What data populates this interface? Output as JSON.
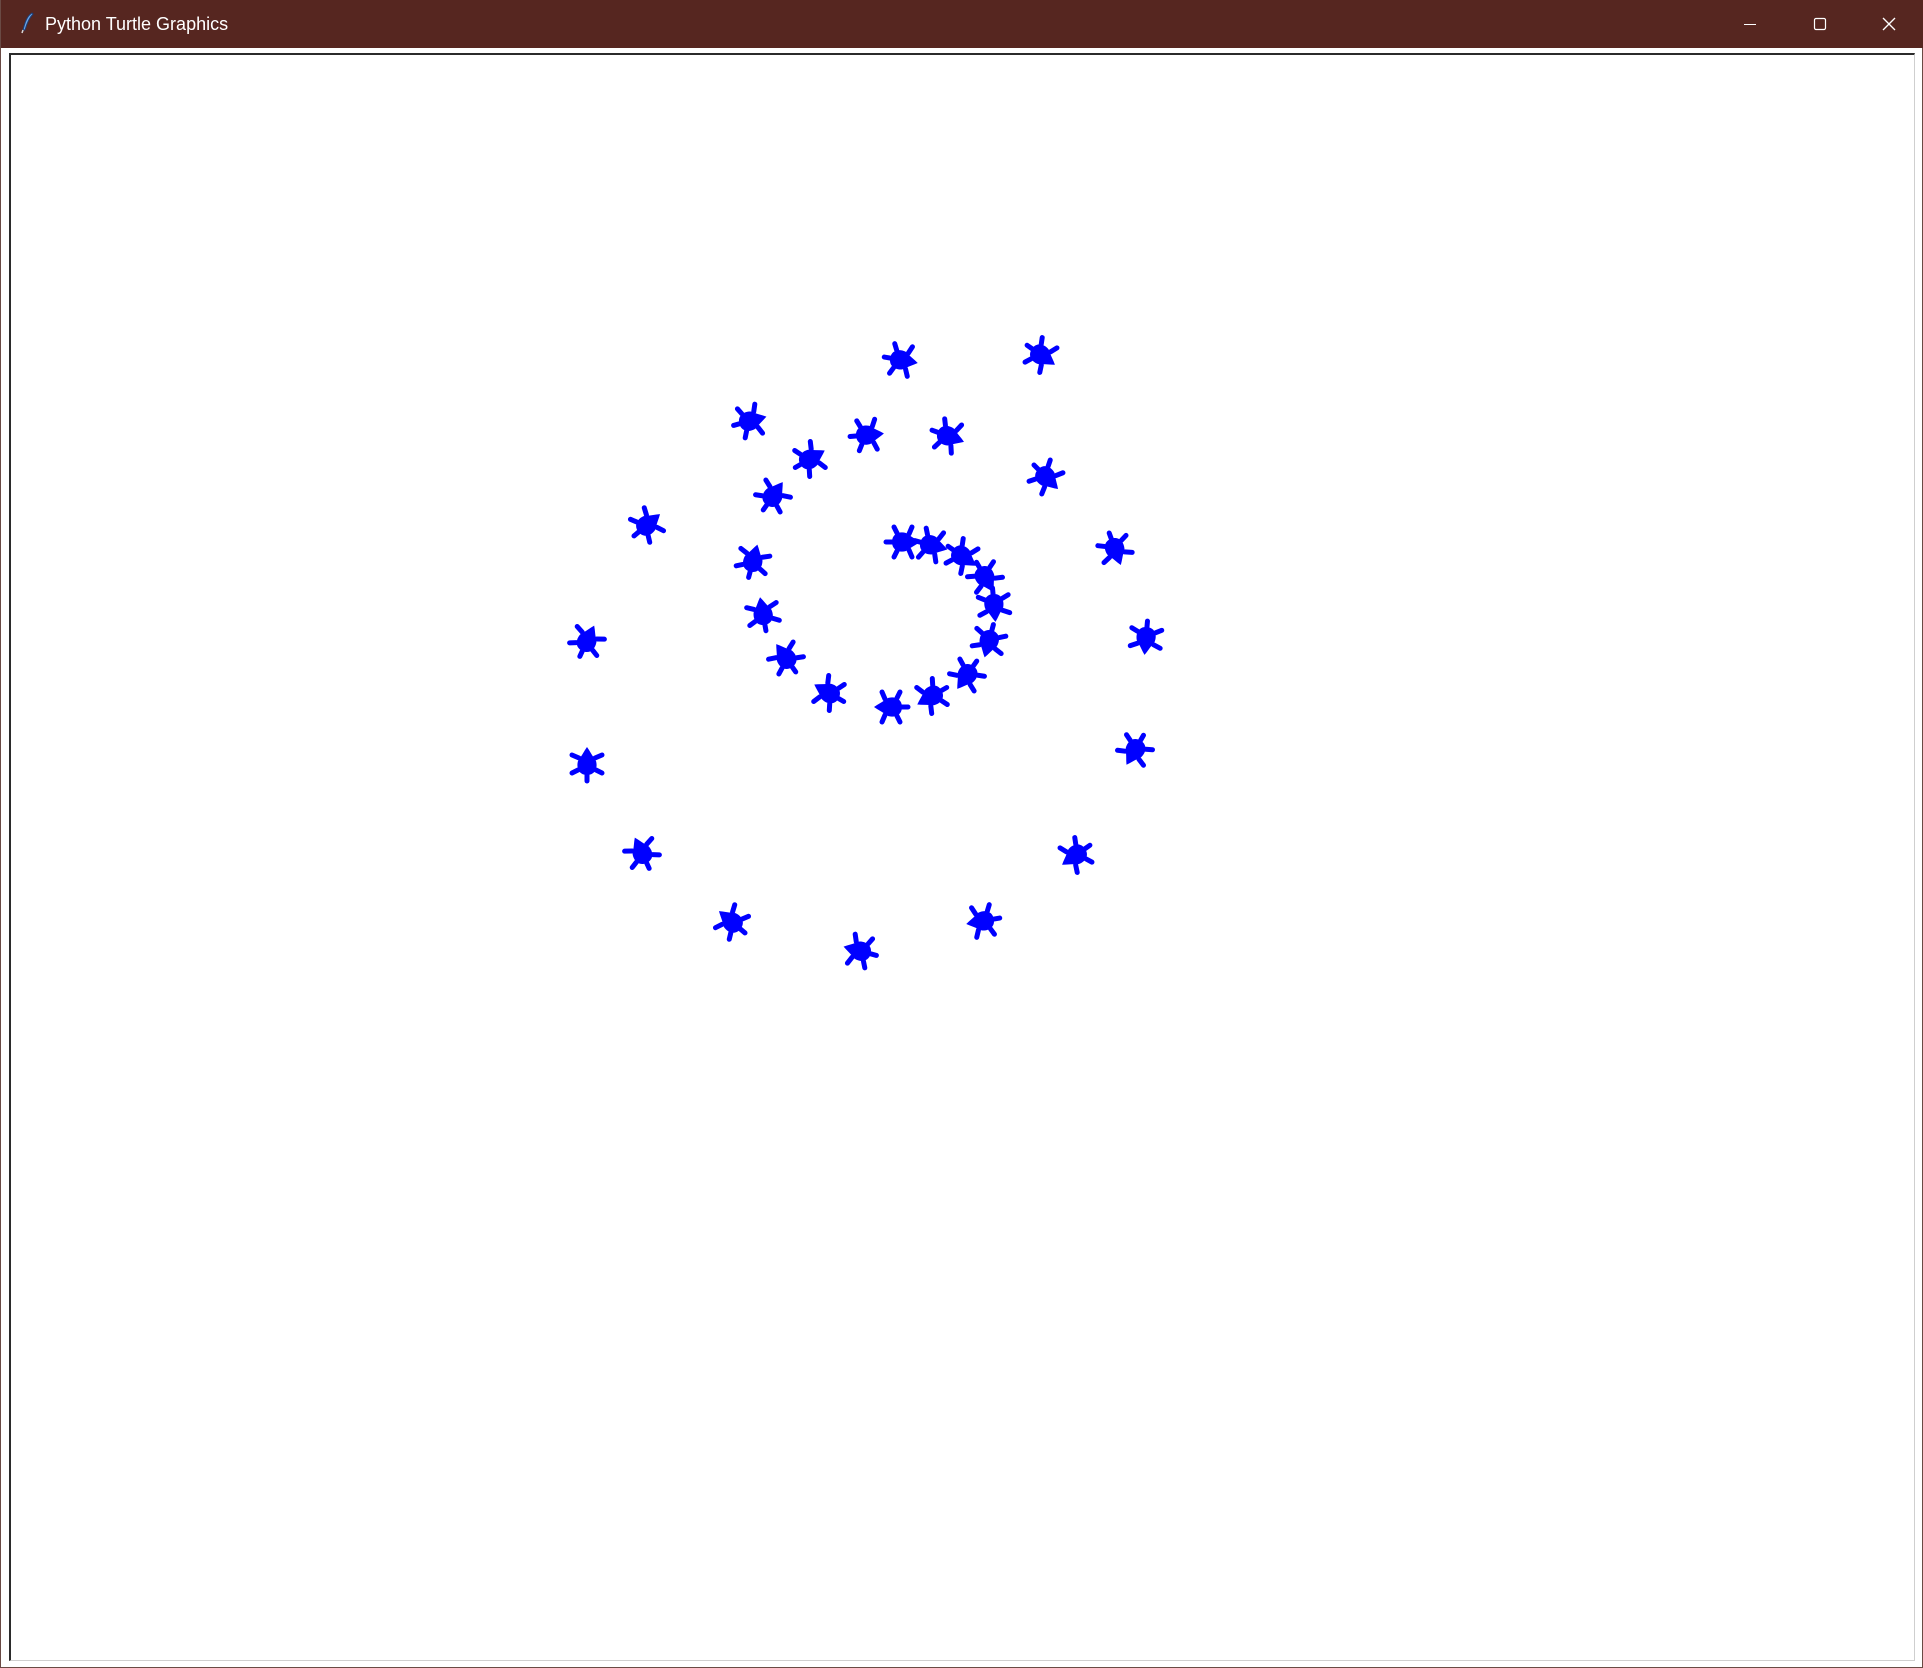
{
  "window": {
    "title": "Python Turtle Graphics",
    "titlebar_color": "#562620",
    "controls": {
      "minimize": "minimize-icon",
      "maximize": "maximize-icon",
      "close": "close-icon"
    }
  },
  "canvas": {
    "background": "#ffffff",
    "turtle_color": "#0000ff",
    "stamp_count": 35
  }
}
